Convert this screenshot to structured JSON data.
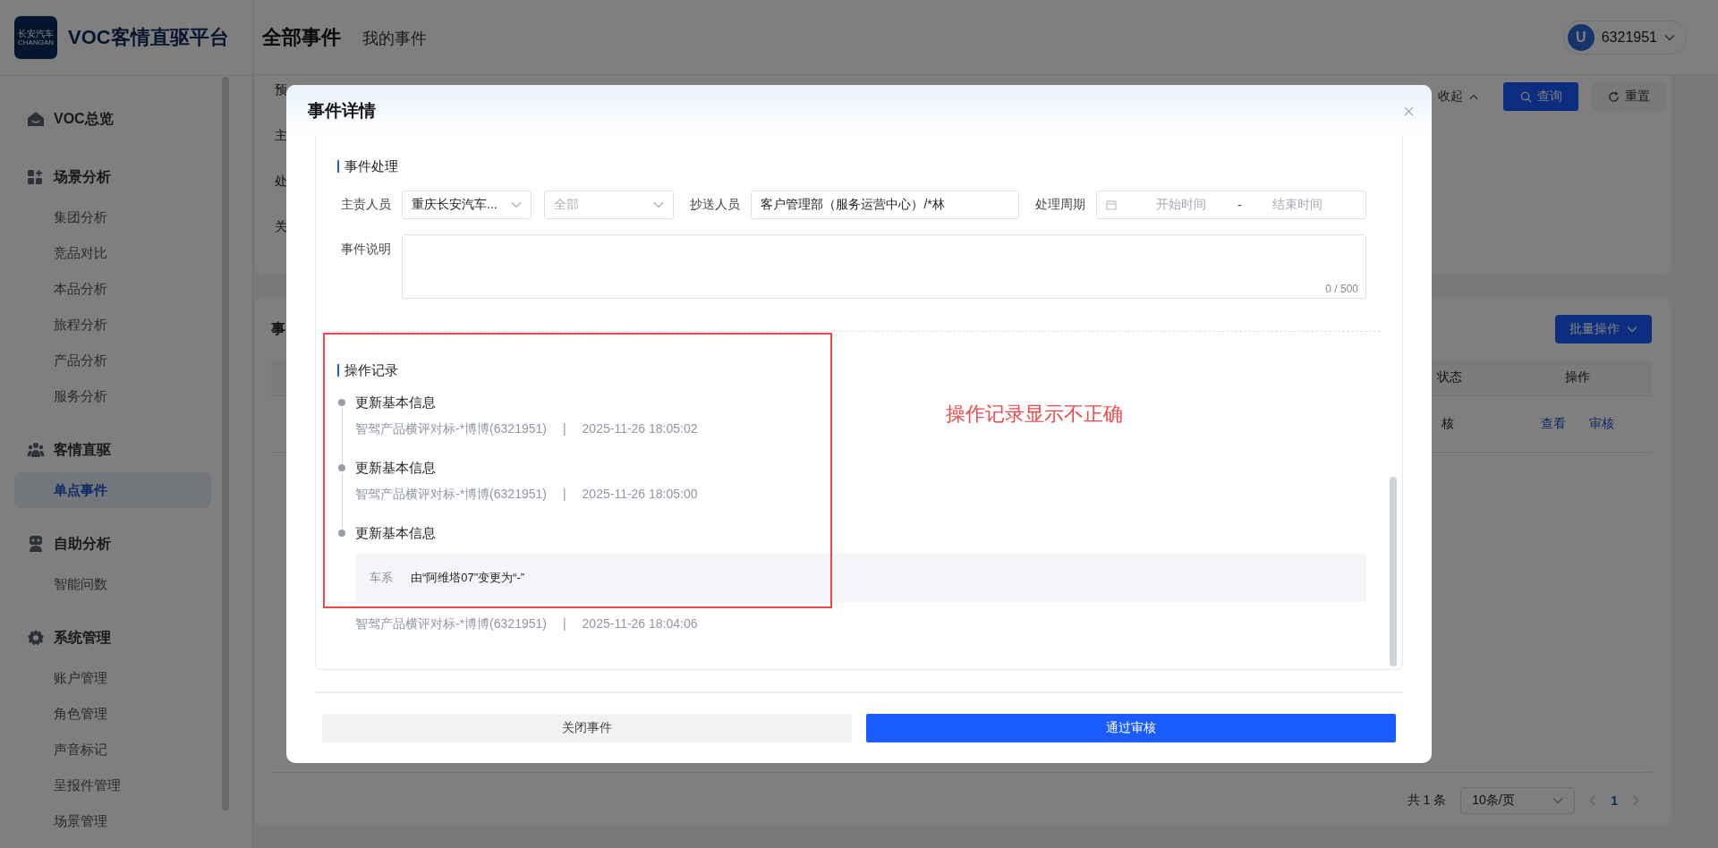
{
  "sidebar": {
    "logo": {
      "name": "长安汽车",
      "latin": "CHANGAN"
    },
    "title": "VOC客情直驱平台",
    "groups": [
      {
        "label": "VOC总览"
      },
      {
        "label": "场景分析",
        "items": [
          {
            "label": "集团分析",
            "selected": false
          },
          {
            "label": "竞品对比",
            "selected": false
          },
          {
            "label": "本品分析",
            "selected": false
          },
          {
            "label": "旅程分析",
            "selected": false
          },
          {
            "label": "产品分析",
            "selected": false
          },
          {
            "label": "服务分析",
            "selected": false
          }
        ]
      },
      {
        "label": "客情直驱",
        "items": [
          {
            "label": "单点事件",
            "selected": true
          }
        ]
      },
      {
        "label": "自助分析",
        "items": [
          {
            "label": "智能问数",
            "selected": false
          }
        ]
      },
      {
        "label": "系统管理",
        "items": [
          {
            "label": "账户管理",
            "selected": false
          },
          {
            "label": "角色管理",
            "selected": false
          },
          {
            "label": "声音标记",
            "selected": false
          },
          {
            "label": "呈报件管理",
            "selected": false
          },
          {
            "label": "场景管理",
            "selected": false
          }
        ]
      }
    ]
  },
  "header": {
    "tabs": [
      {
        "label": "全部事件",
        "selected": true
      },
      {
        "label": "我的事件",
        "selected": false
      }
    ],
    "user": {
      "avatar": "U",
      "name": "6321951"
    }
  },
  "background": {
    "filter_labels": [
      "预",
      "主",
      "处",
      "关"
    ],
    "collapse": "收起",
    "query": "查询",
    "reset": "重置",
    "list_title": "事",
    "batch": "批量操作",
    "columns": [
      "状态",
      "操作"
    ],
    "row": {
      "status": "核",
      "actions": [
        "查看",
        "审核"
      ]
    },
    "pagination": {
      "total": "共 1 条",
      "page_size": "10条/页",
      "pages": [
        {
          "label": "1",
          "selected": true
        }
      ]
    }
  },
  "modal": {
    "title": "事件详情",
    "handling": {
      "title": "事件处理",
      "owner_label": "主责人员",
      "owner_value": "重庆长安汽车...",
      "owner_sub_placeholder": "全部",
      "cc_label": "抄送人员",
      "cc_value": "客户管理部（服务运营中心）/*林",
      "period_label": "处理周期",
      "start_placeholder": "开始时间",
      "separator": "-",
      "end_placeholder": "结束时间",
      "desc_label": "事件说明",
      "desc_counter": "0 / 500"
    },
    "log": {
      "title": "操作记录",
      "entries": [
        {
          "action": "更新基本信息",
          "user": "智驾产品横评对标-*博博(6321951)",
          "separator": "|",
          "time": "2025-11-26 18:05:02"
        },
        {
          "action": "更新基本信息",
          "user": "智驾产品横评对标-*博博(6321951)",
          "separator": "|",
          "time": "2025-11-26 18:05:00"
        },
        {
          "action": "更新基本信息",
          "changes": [
            {
              "field": "车系",
              "text": "由“阿维塔07”变更为“-”"
            }
          ],
          "user": "智驾产品横评对标-*博博(6321951)",
          "separator": "|",
          "time": "2025-11-26 18:04:06"
        }
      ]
    },
    "buttons": [
      {
        "label": "关闭事件",
        "kind": "secondary"
      },
      {
        "label": "通过审核",
        "kind": "primary"
      }
    ]
  },
  "annotation": {
    "text": "操作记录显示不正确"
  }
}
